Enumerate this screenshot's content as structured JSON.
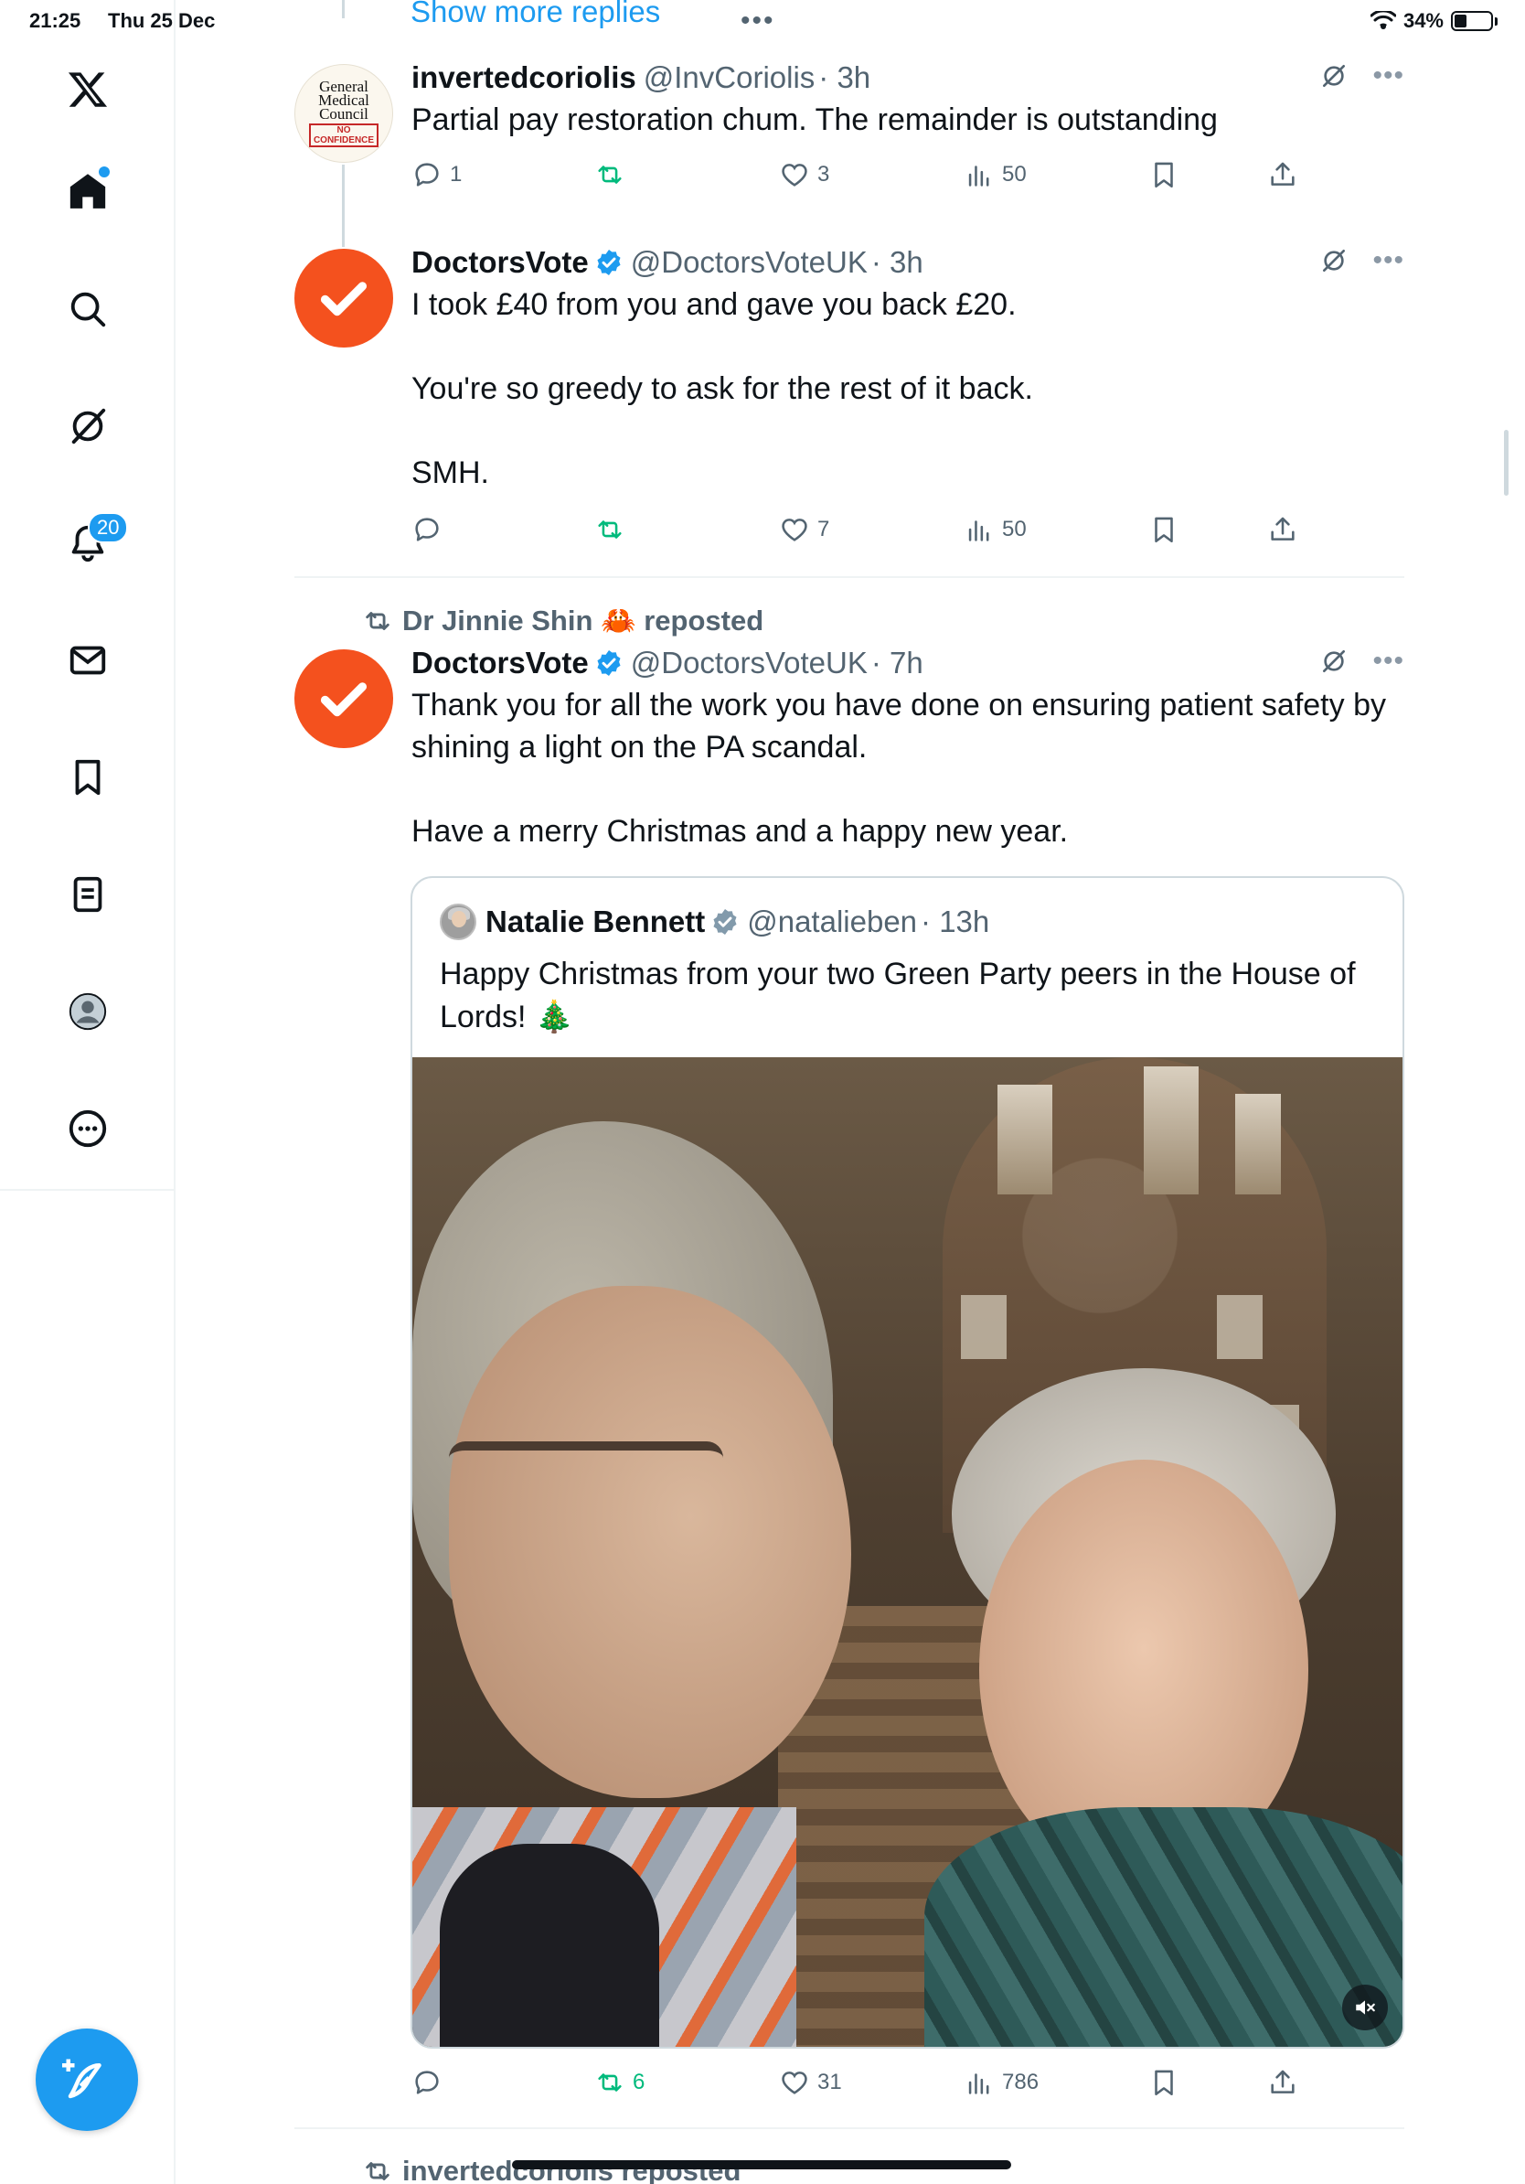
{
  "status_bar": {
    "time": "21:25",
    "date": "Thu 25 Dec",
    "battery": "34%",
    "battery_level": 0.34
  },
  "sidebar": {
    "notifications_badge": "20",
    "icons": [
      "x-logo-icon",
      "home-icon",
      "search-icon",
      "grok-icon",
      "notifications-icon",
      "messages-icon",
      "bookmarks-icon",
      "lists-icon",
      "profile-icon",
      "more-icon"
    ],
    "compose_icon": "compose-icon"
  },
  "thread": {
    "show_more_replies": "Show more replies",
    "ellipsis": "•••"
  },
  "tweets": [
    {
      "display_name": "invertedcoriolis",
      "handle": "@InvCoriolis",
      "time": "· 3h",
      "text": "Partial pay restoration chum. The remainder is outstanding",
      "replies": "1",
      "reposts": "",
      "likes": "3",
      "views": "50",
      "avatar": {
        "line1": "General",
        "line2": "Medical",
        "line3": "Council",
        "stamp1": "NO",
        "stamp2": "CONFIDENCE"
      }
    },
    {
      "display_name": "DoctorsVote",
      "handle": "@DoctorsVoteUK",
      "time": "· 3h",
      "text": "I took £40 from you and gave you back £20.\n\nYou're so greedy to ask for the rest of it back.\n\nSMH.",
      "replies": "",
      "reposts": "",
      "likes": "7",
      "views": "50"
    },
    {
      "reposted_by": "Dr Jinnie Shin 🦀 reposted",
      "display_name": "DoctorsVote",
      "handle": "@DoctorsVoteUK",
      "time": "· 7h",
      "text": "Thank you for all the work you have done on ensuring patient safety by shining a light on the PA scandal.\n\nHave a merry Christmas and a happy new year.",
      "replies": "",
      "reposts": "6",
      "likes": "31",
      "views": "786",
      "quote": {
        "display_name": "Natalie Bennett",
        "handle": "@natalieben",
        "time": "· 13h",
        "text": "Happy Christmas from your two Green Party peers in the House of Lords! 🎄"
      }
    }
  ],
  "next_repost": "invertedcoriolis reposted",
  "colors": {
    "accent": "#1d9bf0",
    "repost_green": "#00ba7c",
    "avatar_orange": "#f4511e",
    "text_secondary": "#536471"
  }
}
